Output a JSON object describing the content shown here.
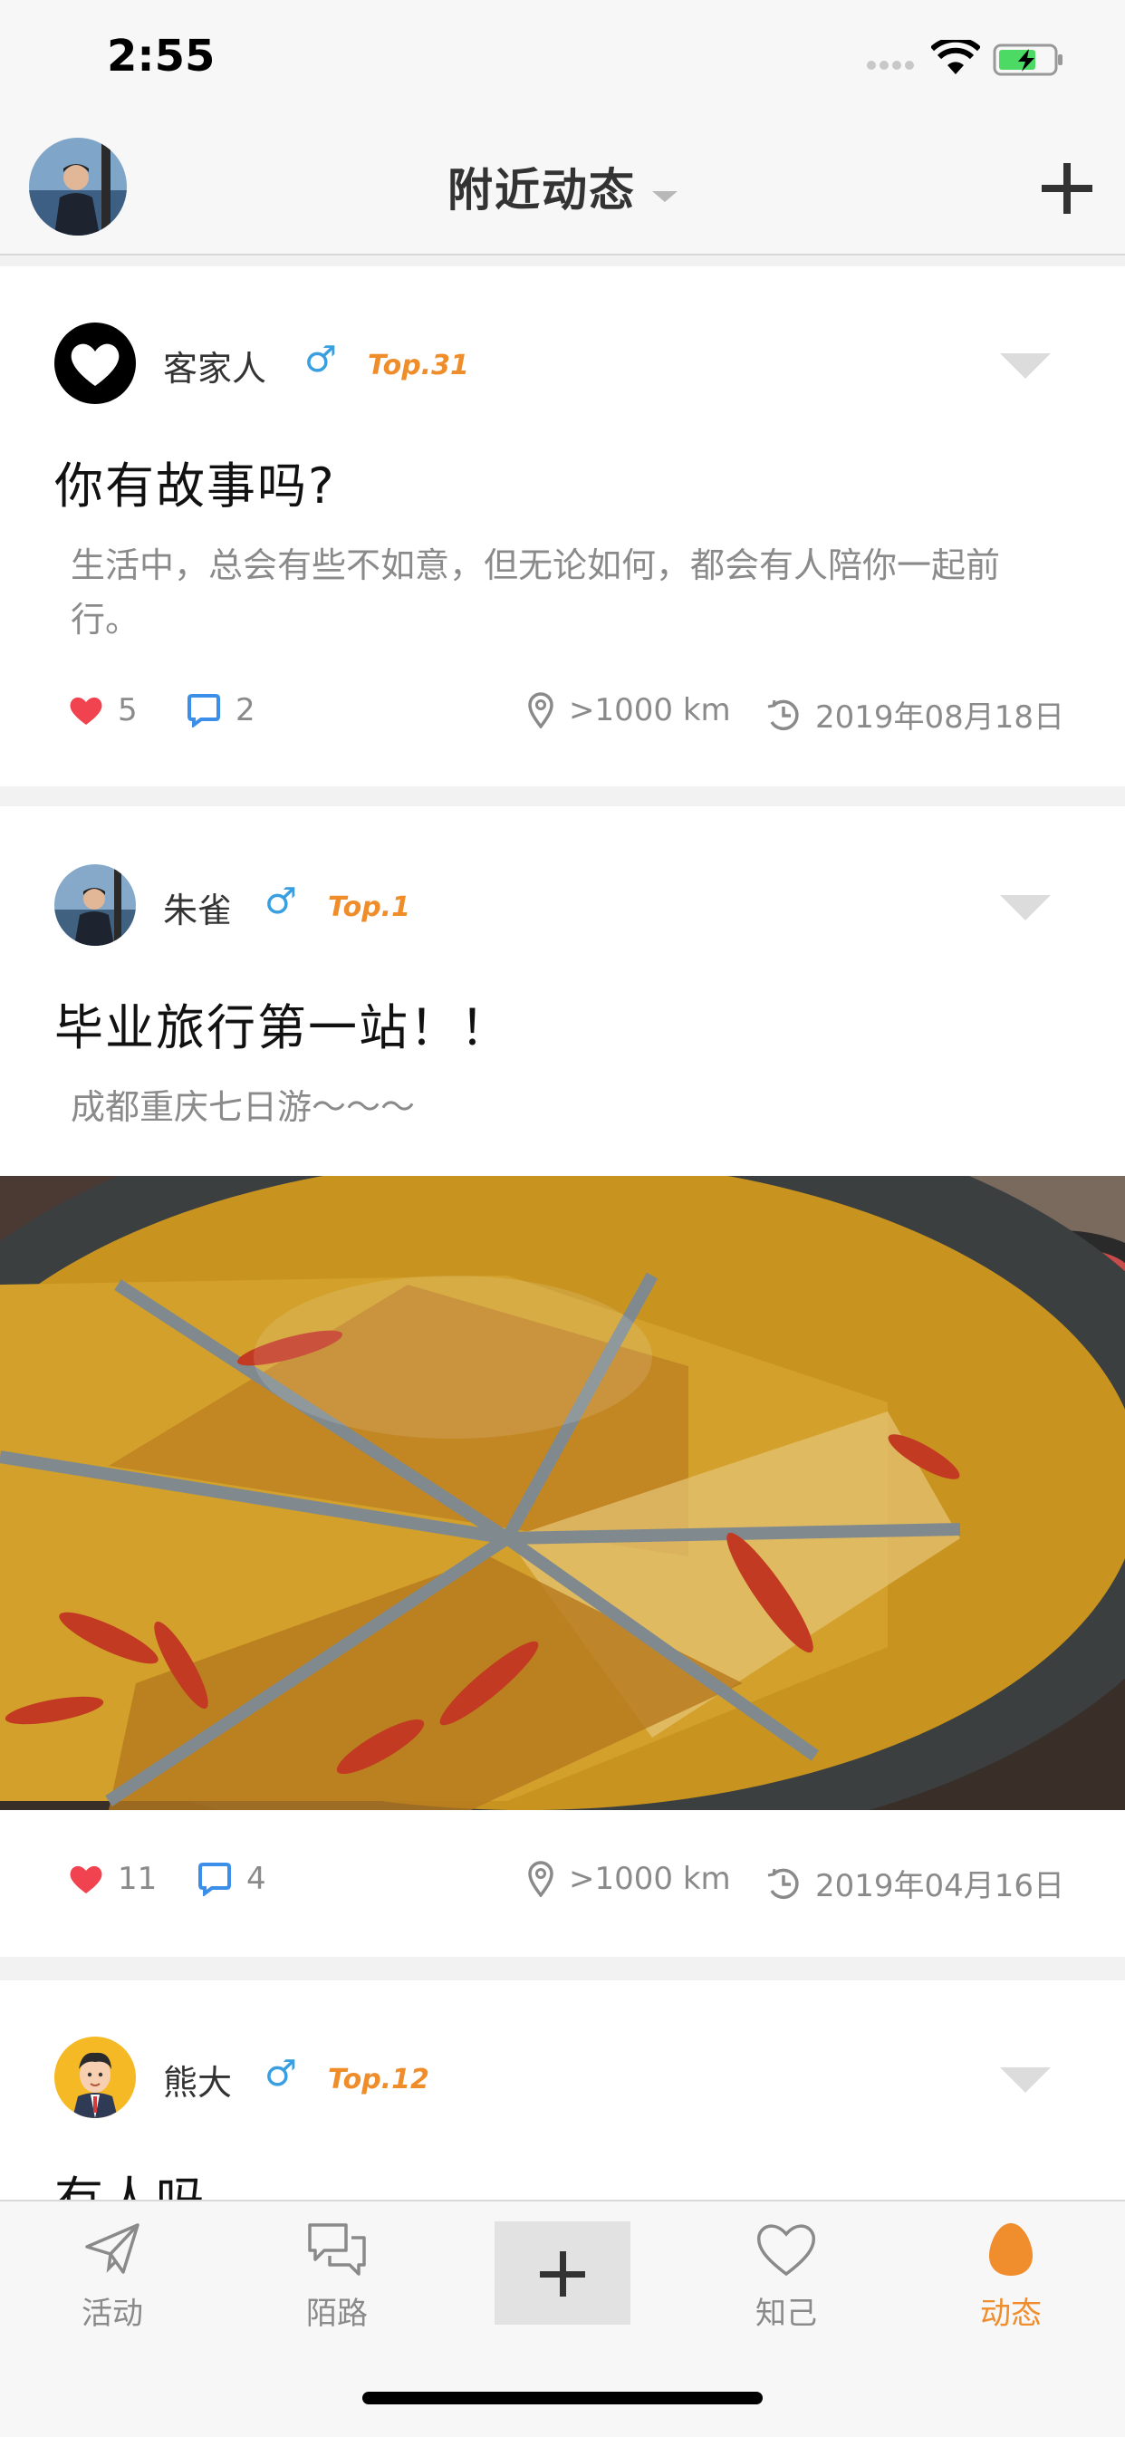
{
  "status": {
    "time": "2:55"
  },
  "nav": {
    "title": "附近动态"
  },
  "posts": [
    {
      "user": "客家人",
      "gender": "♂",
      "rank": "Top.31",
      "title": "你有故事吗?",
      "body": "生活中，总会有些不如意，但无论如何，都会有人陪你一起前行。",
      "likes": "5",
      "comments": "2",
      "distance": ">1000 km",
      "date": "2019年08月18日"
    },
    {
      "user": "朱雀",
      "gender": "♂",
      "rank": "Top.1",
      "title": "毕业旅行第一站！！",
      "body": "成都重庆七日游～～～",
      "likes": "11",
      "comments": "4",
      "distance": ">1000 km",
      "date": "2019年04月16日"
    },
    {
      "user": "熊大",
      "gender": "♂",
      "rank": "Top.12",
      "title": "有人吗"
    }
  ],
  "tabs": [
    {
      "label": "活动",
      "icon": "paper-plane-icon"
    },
    {
      "label": "陌路",
      "icon": "chat-bubbles-icon"
    },
    {
      "label": "",
      "icon": "plus-icon"
    },
    {
      "label": "知己",
      "icon": "heart-outline-icon"
    },
    {
      "label": "动态",
      "icon": "egg-icon",
      "active": true
    }
  ],
  "colors": {
    "accent": "#f08d2c",
    "like": "#f0434f",
    "comment": "#3b8fe8",
    "gender": "#3a9fe0",
    "rank": "#ef8d2b"
  }
}
